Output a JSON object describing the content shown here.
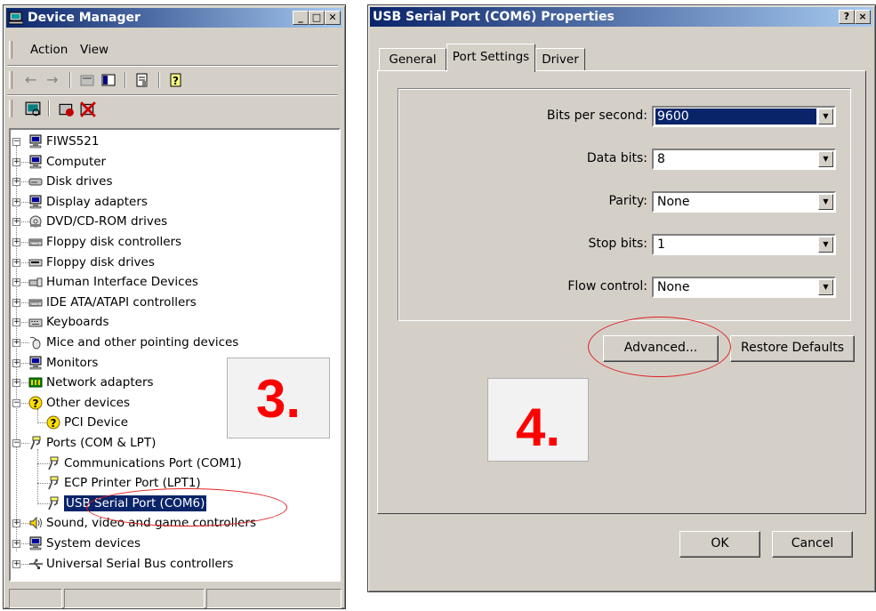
{
  "device_manager": {
    "title": "Device Manager",
    "menu": {
      "action": "Action",
      "view": "View"
    },
    "computer_name": "FIWS521",
    "categories": [
      {
        "label": "Computer",
        "icon": "monitor-icon",
        "expanded": false
      },
      {
        "label": "Disk drives",
        "icon": "disk-icon",
        "expanded": false
      },
      {
        "label": "Display adapters",
        "icon": "monitor-icon",
        "expanded": false
      },
      {
        "label": "DVD/CD-ROM drives",
        "icon": "cdrom-icon",
        "expanded": false
      },
      {
        "label": "Floppy disk controllers",
        "icon": "controller-icon",
        "expanded": false
      },
      {
        "label": "Floppy disk drives",
        "icon": "floppy-icon",
        "expanded": false
      },
      {
        "label": "Human Interface Devices",
        "icon": "hid-icon",
        "expanded": false
      },
      {
        "label": "IDE ATA/ATAPI controllers",
        "icon": "controller-icon",
        "expanded": false
      },
      {
        "label": "Keyboards",
        "icon": "keyboard-icon",
        "expanded": false
      },
      {
        "label": "Mice and other pointing devices",
        "icon": "mouse-icon",
        "expanded": false
      },
      {
        "label": "Monitors",
        "icon": "monitor-icon",
        "expanded": false
      },
      {
        "label": "Network adapters",
        "icon": "network-icon",
        "expanded": false
      },
      {
        "label": "Other devices",
        "icon": "question-icon",
        "expanded": true
      },
      {
        "label": "PCI Device",
        "icon": "question-icon",
        "child": true
      },
      {
        "label": "Ports (COM & LPT)",
        "icon": "port-icon",
        "expanded": true
      },
      {
        "label": "Communications Port (COM1)",
        "icon": "port-icon",
        "child": true
      },
      {
        "label": "ECP Printer Port (LPT1)",
        "icon": "port-icon",
        "child": true
      },
      {
        "label": "USB Serial Port (COM6)",
        "icon": "port-icon",
        "child": true,
        "selected": true
      },
      {
        "label": "Sound, video and game controllers",
        "icon": "speaker-icon",
        "expanded": false
      },
      {
        "label": "System devices",
        "icon": "monitor-icon",
        "expanded": false
      },
      {
        "label": "Universal Serial Bus controllers",
        "icon": "usb-icon",
        "expanded": false
      }
    ]
  },
  "step3": "3.",
  "properties": {
    "title": "USB Serial Port (COM6) Properties",
    "help_btn": "?",
    "close_btn": "×",
    "tabs": {
      "general": "General",
      "port_settings": "Port Settings",
      "driver": "Driver"
    },
    "fields": {
      "bits_label": "Bits per second:",
      "bits_value": "9600",
      "data_label": "Data bits:",
      "data_value": "8",
      "parity_label": "Parity:",
      "parity_value": "None",
      "stop_label": "Stop bits:",
      "stop_value": "1",
      "flow_label": "Flow control:",
      "flow_value": "None"
    },
    "advanced_btn": "Advanced...",
    "restore_btn": "Restore Defaults",
    "ok_btn": "OK",
    "cancel_btn": "Cancel"
  },
  "step4": "4.",
  "colors": {
    "title_start": "#0a246a",
    "title_end": "#a6caf0",
    "selection": "#0a246a",
    "highlight_oval": "#e02020",
    "step_text": "#ff0000"
  }
}
